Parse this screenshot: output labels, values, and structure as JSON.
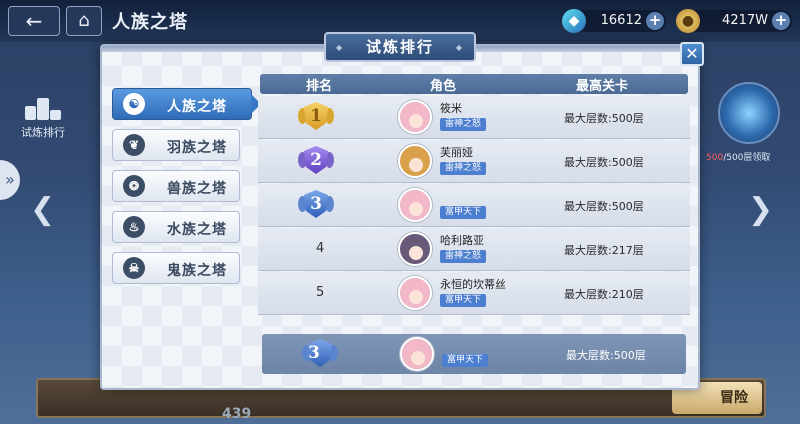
{
  "header": {
    "back_label": "←",
    "home_label": "⌂",
    "page_title": "人族之塔",
    "resources": [
      {
        "icon": "gem-icon",
        "value": "16612",
        "plus": "+"
      },
      {
        "icon": "coin-icon",
        "value": "4217W",
        "plus": "+"
      }
    ]
  },
  "side": {
    "rank_label": "试炼排行",
    "reward_progress_red": "500",
    "reward_progress_rest": "/500层领取",
    "left_arrow": "❮",
    "right_arrow": "❯",
    "edge_arrow": "»"
  },
  "bottom": {
    "adventure_label": "冒险",
    "number": "439"
  },
  "dialog": {
    "title": "试炼排行",
    "close_label": "✕",
    "tabs": [
      {
        "label": "人族之塔",
        "icon": "human-icon",
        "glyph": "☯",
        "active": true
      },
      {
        "label": "羽族之塔",
        "icon": "feather-icon",
        "glyph": "❦",
        "active": false
      },
      {
        "label": "兽族之塔",
        "icon": "beast-icon",
        "glyph": "❂",
        "active": false
      },
      {
        "label": "水族之塔",
        "icon": "water-icon",
        "glyph": "♨",
        "active": false
      },
      {
        "label": "鬼族之塔",
        "icon": "skull-icon",
        "glyph": "☠",
        "active": false
      }
    ],
    "columns": [
      "排名",
      "角色",
      "最高关卡"
    ],
    "rows": [
      {
        "rank": "1",
        "badge": "gold",
        "name": "筱米",
        "tag": "雷神之怒",
        "floor": "最大层数:500层",
        "hair": "#f2b8c8"
      },
      {
        "rank": "2",
        "badge": "purple",
        "name": "芙丽娅",
        "tag": "雷神之怒",
        "floor": "最大层数:500层",
        "hair": "#d9a24a"
      },
      {
        "rank": "3",
        "badge": "blue",
        "name": "",
        "tag": "富甲天下",
        "floor": "最大层数:500层",
        "hair": "#f2b8c8"
      },
      {
        "rank": "4",
        "badge": "",
        "name": "哈利路亚",
        "tag": "雷神之怒",
        "floor": "最大层数:217层",
        "hair": "#6a5a7a"
      },
      {
        "rank": "5",
        "badge": "",
        "name": "永恒的坎蒂丝",
        "tag": "富甲天下",
        "floor": "最大层数:210层",
        "hair": "#f2b8c8"
      }
    ],
    "my_rank": {
      "rank": "3",
      "badge": "blue",
      "tag": "富甲天下",
      "floor": "最大层数:500层",
      "hair": "#f2b8c8"
    }
  },
  "colors": {
    "gold_badge": "#e8b93a",
    "purple_badge": "#7a5ad0",
    "blue_badge": "#3d6fc8",
    "tag_blue": "#4d7fd0"
  }
}
